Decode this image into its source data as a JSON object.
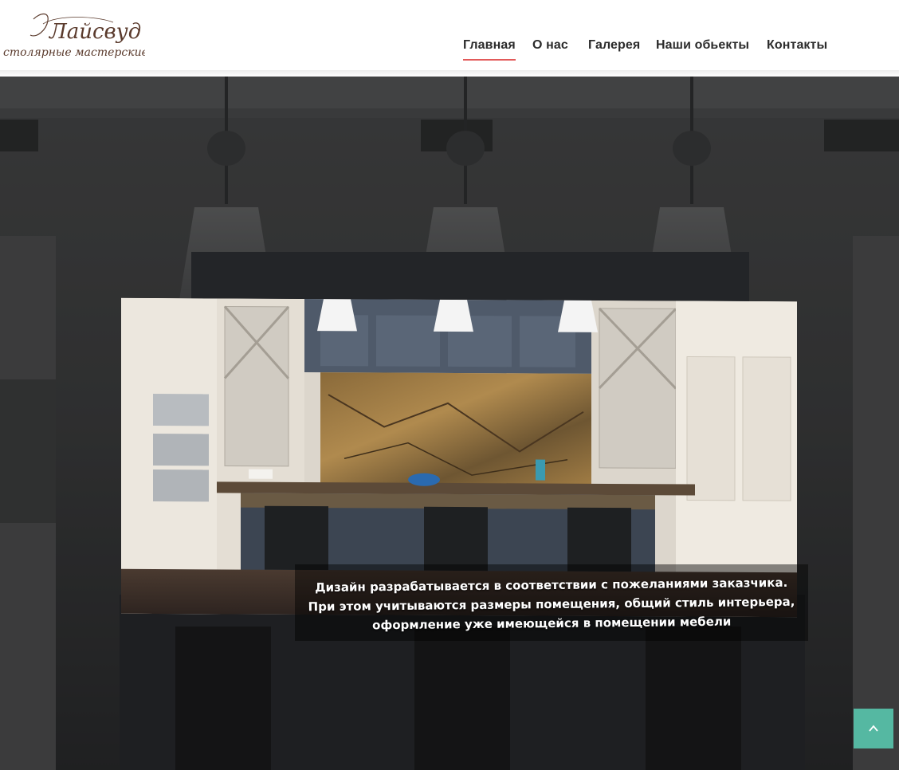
{
  "logo": {
    "title": "Лайсвуд",
    "subtitle": "столярные мастерские"
  },
  "nav": {
    "items": [
      {
        "label": "Главная",
        "active": true
      },
      {
        "label": "О нас",
        "active": false
      },
      {
        "label": "Галерея",
        "active": false
      },
      {
        "label": "Наши обьекты",
        "active": false
      },
      {
        "label": "Контакты",
        "active": false
      }
    ]
  },
  "hero": {
    "caption_line1": "Дизайн разрабатывается в соответствии с пожеланиями заказчика.",
    "caption_line2": "При этом учитываются размеры помещения, общий стиль интерьера,",
    "caption_line3": "оформление уже имеющейся в помещении мебели"
  },
  "scroll_top": {
    "icon": "chevron-up-icon"
  },
  "colors": {
    "accent_underline": "#e25a5a",
    "scroll_button": "#55b8a2",
    "logo_text": "#5a3a2c"
  }
}
